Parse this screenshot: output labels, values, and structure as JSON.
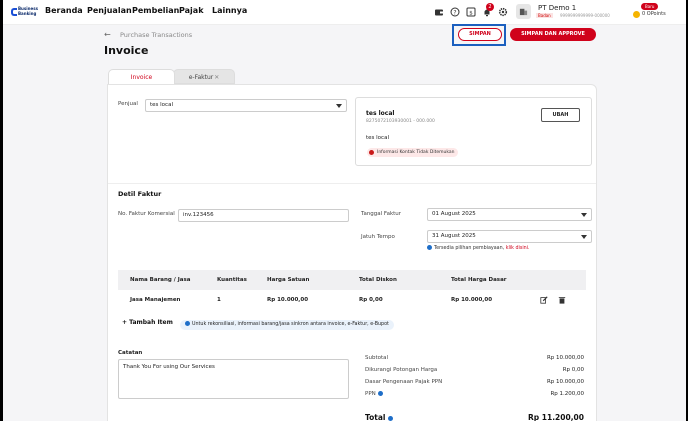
{
  "brand": {
    "line1": "Business",
    "line2": "Banking",
    "color": "#1a4fd6"
  },
  "nav": {
    "items": [
      "Beranda",
      "Penjualan",
      "Pembelian",
      "Pajak",
      "Lainnya"
    ]
  },
  "header_icons": [
    "wallet-icon",
    "help-icon",
    "invoice-icon",
    "bell-icon",
    "gear-icon",
    "building-icon"
  ],
  "notification_count": "2",
  "company": {
    "name": "PT Demo 1",
    "badan_label": "Badan",
    "npwp": "9999999999999-000000"
  },
  "points": {
    "new_label": "Baru",
    "value": "0 OPoints"
  },
  "breadcrumb": "Purchase Transactions",
  "page_title": "Invoice",
  "actions": {
    "save": "SIMPAN",
    "save_approve": "SIMPAN DAN APPROVE"
  },
  "tabs": [
    {
      "label": "Invoice",
      "active": true
    },
    {
      "label": "e-Faktur",
      "active": false
    }
  ],
  "seller": {
    "label": "Penjual",
    "selected": "tes local",
    "card_name": "tes local",
    "card_id": "8275072103930001 - 000.000",
    "card_sub": "tes local",
    "warning": "Informasi Kontak Tidak Ditemukan",
    "change_button": "UBAH"
  },
  "detail": {
    "section_title": "Detil Faktur",
    "commercial_no_label": "No. Faktur Komersial",
    "commercial_no_value": "inv.123456",
    "invoice_date_label": "Tanggal Faktur",
    "invoice_date": "01 August 2025",
    "due_date_label": "Jatuh Tempo",
    "due_date": "31 August 2025",
    "financing_note": "Tersedia pilihan pembiayaan,",
    "financing_link": "klik disini."
  },
  "table": {
    "headers": [
      "Nama Barang / Jasa",
      "Kuantitas",
      "Harga Satuan",
      "Total Diskon",
      "Total Harga Dasar"
    ],
    "rows": [
      [
        "Jasa Manajemen",
        "1",
        "Rp 10.000,00",
        "Rp 0,00",
        "Rp 10.000,00"
      ]
    ]
  },
  "add_item": "Tambah Item",
  "sync_note": "Untuk rekonsiliasi, informasi barang/jasa sinkron antara invoice, e-Faktur, e-Bupot",
  "notes": {
    "label": "Catatan",
    "value": "Thank You For using Our Services"
  },
  "summary": [
    {
      "label": "Subtotal",
      "value": "Rp 10.000,00"
    },
    {
      "label": "Dikurangi Potongan Harga",
      "value": "Rp 0,00"
    },
    {
      "label": "Dasar Pengenaan Pajak PPN",
      "value": "Rp 10.000,00"
    },
    {
      "label": "PPN",
      "value": "Rp 1.200,00"
    }
  ],
  "total": {
    "label": "Total",
    "value": "Rp 11.200,00"
  },
  "colors": {
    "primary": "#d0021b",
    "info": "#1e6ec8",
    "focus": "#1b5fbf"
  }
}
